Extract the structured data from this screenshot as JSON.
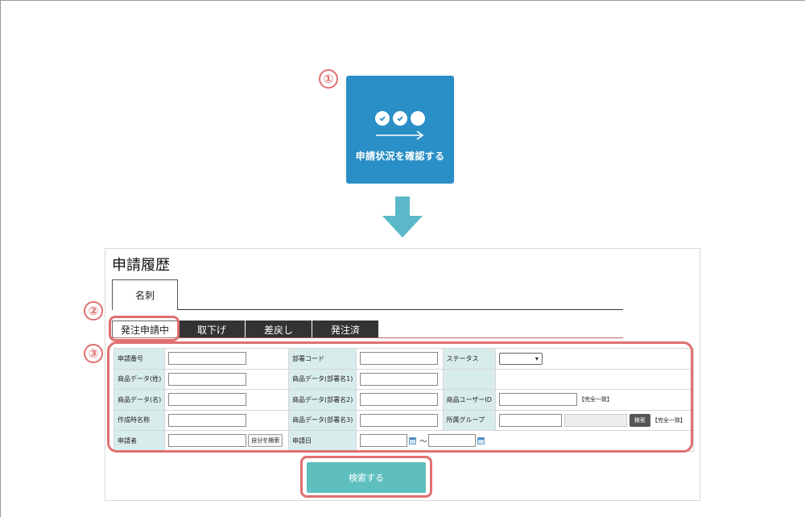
{
  "callouts": [
    "①",
    "②",
    "③"
  ],
  "status_tile": {
    "label": "申請状況を確認する"
  },
  "page": {
    "title": "申請履歴"
  },
  "card_tab": {
    "label": "名刺"
  },
  "status_tabs": [
    {
      "label": "発注申請中",
      "active": true
    },
    {
      "label": "取下げ",
      "active": false
    },
    {
      "label": "差戻し",
      "active": false
    },
    {
      "label": "発注済",
      "active": false
    }
  ],
  "form": {
    "application_no": "申請番号",
    "dept_code": "部署コード",
    "status": "ステータス",
    "item_last_name": "商品データ(姓)",
    "item_dept1": "商品データ(部署名1)",
    "item_first_name": "商品データ(名)",
    "item_dept2": "商品データ(部署名2)",
    "item_user_id": "商品ユーザーID",
    "exact_match": "【完全一致】",
    "creation_name": "作成時名称",
    "item_dept3": "商品データ(部署名3)",
    "group": "所属グループ",
    "search_small": "検索",
    "applicant": "申請者",
    "self_search": "自分を検索",
    "apply_date": "申請日",
    "tilde": "～"
  },
  "search_button": {
    "label": "検索する"
  },
  "colors": {
    "accent_blue": "#2a8fc7",
    "teal": "#5fbfbf",
    "arrow": "#5bb8c8",
    "callout": "#e07070",
    "label_bg": "#d9ecec"
  }
}
